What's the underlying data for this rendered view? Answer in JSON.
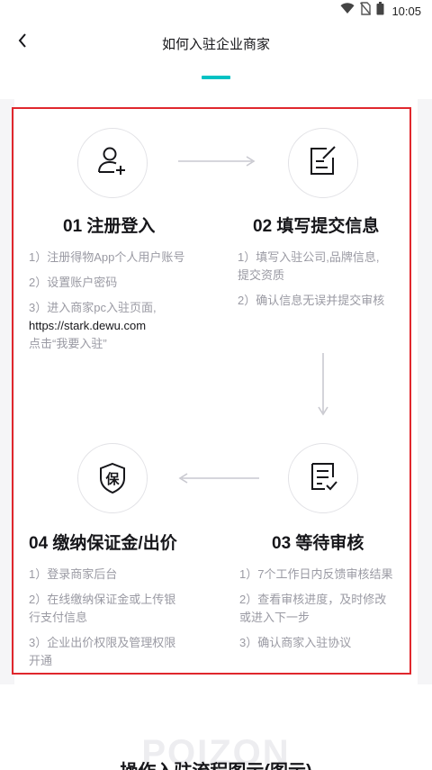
{
  "status_bar": {
    "time": "10:05",
    "icons": [
      "wifi-icon",
      "no-sim-icon",
      "battery-icon"
    ]
  },
  "nav": {
    "back_icon": "chevron-left-icon",
    "title": "如何入驻企业商家"
  },
  "colors": {
    "accent": "#01c2c3",
    "highlight": "#e0272d",
    "muted_text": "#9a9aa3",
    "dark_text": "#16161a"
  },
  "steps": [
    {
      "icon": "add-user-icon",
      "title": "01 注册登入",
      "lines": [
        "1）注册得物App个人用户账号",
        "2）设置账户密码",
        "3）进入商家pc入驻页面,"
      ],
      "url": "https://stark.dewu.com",
      "url_note": "点击“我要入驻”"
    },
    {
      "icon": "edit-form-icon",
      "title": "02 填写提交信息",
      "lines": [
        "1）填写入驻公司,品牌信息,",
        "提交资质",
        "2）确认信息无误并提交审核"
      ]
    },
    {
      "icon": "checklist-icon",
      "title": "03 等待审核",
      "lines": [
        "1）7个工作日内反馈审核结果",
        "2）查看审核进度，及时修改",
        "或进入下一步",
        "3）确认商家入驻协议"
      ]
    },
    {
      "icon": "deposit-shield-icon",
      "icon_glyph": "保",
      "title": "04 缴纳保证金/出价",
      "lines": [
        "1）登录商家后台",
        "2）在线缴纳保证金或上传银",
        "行支付信息",
        "3）企业出价权限及管理权限",
        "开通"
      ]
    }
  ],
  "footer": {
    "brand_watermark": "POIZON",
    "heading": "操作入驻流程图示(图示)"
  }
}
